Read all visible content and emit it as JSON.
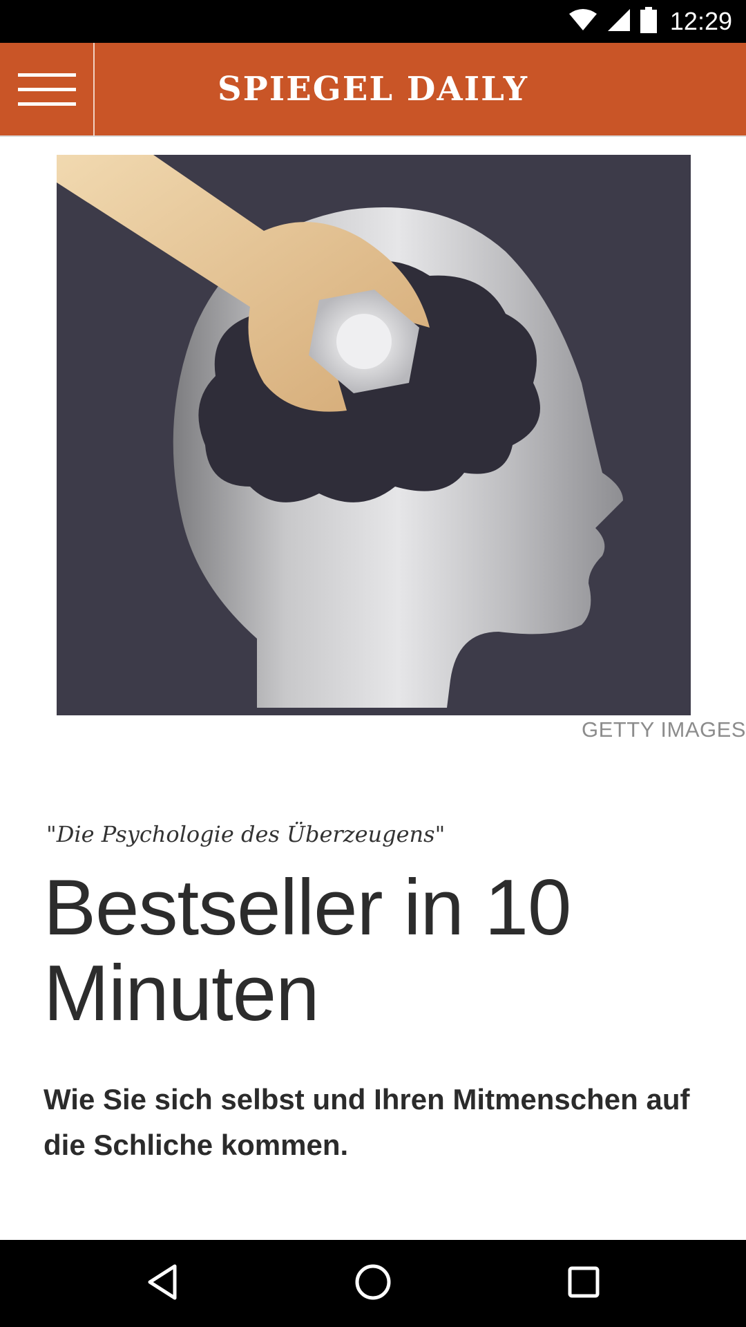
{
  "status_bar": {
    "time": "12:29",
    "icons": [
      "wifi-icon",
      "signal-icon",
      "battery-icon"
    ]
  },
  "header": {
    "title": "SPIEGEL DAILY",
    "menu_icon": "hamburger-menu-icon",
    "background_color": "#c95527"
  },
  "hero": {
    "image_description_icon": "head-wrench-illustration",
    "credit": "GETTY IMAGES"
  },
  "article": {
    "kicker": "\"Die Psychologie des Überzeugens\"",
    "headline": "Bestseller in 10 Minuten",
    "teaser": "Wie Sie sich selbst und Ihren Mitmenschen auf die Schliche kommen."
  },
  "nav_bar": {
    "icons": [
      "back-icon",
      "home-icon",
      "recents-icon"
    ]
  }
}
